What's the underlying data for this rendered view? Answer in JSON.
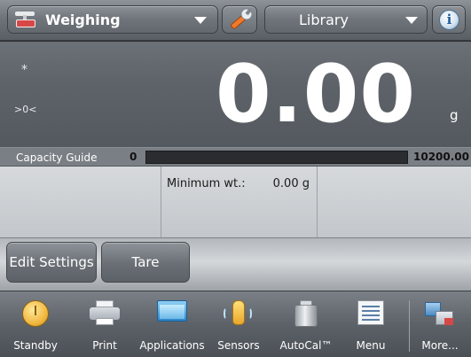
{
  "top_bar": {
    "app_label": "Weighing",
    "library_label": "Library",
    "icons": {
      "app": "weighing-scale-icon",
      "wrench": "wrench-icon",
      "info": "info-icon"
    },
    "info_glyph": "i"
  },
  "display": {
    "stability": "*",
    "zero_indicator": ">0<",
    "weight": "0.00",
    "unit": "g"
  },
  "capacity_guide": {
    "title": "Capacity Guide",
    "min": "0",
    "max": "10200.00",
    "fill_fraction": 0
  },
  "info_fields": [
    {
      "label": "",
      "value": ""
    },
    {
      "label": "Minimum wt.:",
      "value": "0.00 g"
    },
    {
      "label": "",
      "value": ""
    }
  ],
  "actions": {
    "edit_settings": "Edit Settings",
    "tare": "Tare"
  },
  "nav": {
    "items": [
      {
        "label": "Standby",
        "icon": "standby-icon"
      },
      {
        "label": "Print",
        "icon": "printer-icon"
      },
      {
        "label": "Applications",
        "icon": "applications-icon"
      },
      {
        "label": "Sensors",
        "icon": "sensor-hand-icon"
      },
      {
        "label": "AutoCal™",
        "icon": "calibration-weight-icon"
      },
      {
        "label": "Menu",
        "icon": "menu-icon"
      },
      {
        "label": "More...",
        "icon": "more-icon"
      }
    ]
  },
  "colors": {
    "weight_text": "#ffffff",
    "capacity_track": "#2a2c2f",
    "sensor_hand": "#e8a62b",
    "standby": "#f0b53a"
  }
}
